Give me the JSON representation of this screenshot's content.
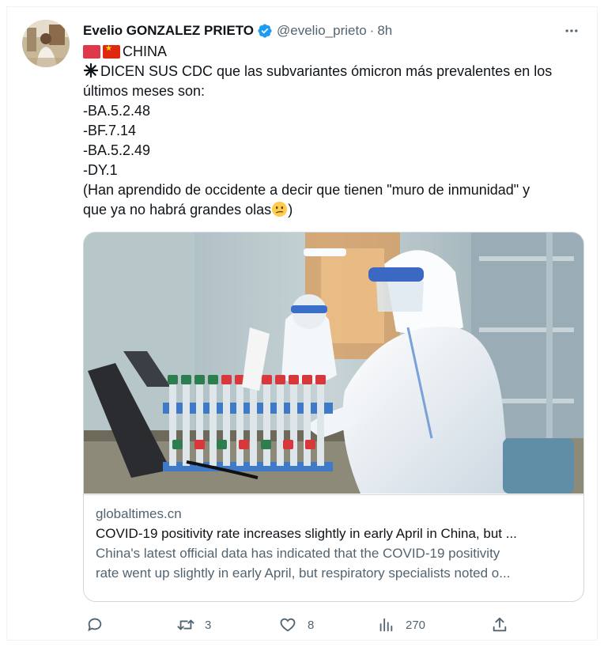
{
  "author": {
    "display_name": "Evelio GONZALEZ PRIETO",
    "verified_icon": "verified-badge-icon",
    "handle": "@evelio_prieto",
    "separator": "·",
    "time": "8h"
  },
  "tweet": {
    "lines": [
      "CHINA",
      "DICEN SUS CDC que las subvariantes ómicron más prevalentes en los",
      "últimos meses son:",
      "-BA.5.2.48",
      "-BF.7.14",
      "-BA.5.2.49",
      "-DY.1",
      "(Han aprendido de occidente a decir que tienen \"muro de inmunidad\" y",
      "que ya no habrá grandes olas",
      ")"
    ]
  },
  "card": {
    "domain": "globaltimes.cn",
    "title": "COVID-19 positivity rate increases slightly in early April in China, but ...",
    "description_lines": [
      "China's latest official data has indicated that the COVID-19 positivity",
      "rate went up slightly in early April, but respiratory specialists noted o..."
    ]
  },
  "actions": {
    "reply": {
      "icon": "reply-icon",
      "count": ""
    },
    "retweet": {
      "icon": "retweet-icon",
      "count": "3"
    },
    "like": {
      "icon": "heart-icon",
      "count": "8"
    },
    "views": {
      "icon": "views-icon",
      "count": "270"
    },
    "share": {
      "icon": "share-icon",
      "count": ""
    }
  },
  "colors": {
    "text_primary": "#0f1419",
    "text_secondary": "#536471",
    "verified": "#1d9bf0",
    "border": "#cfd9de"
  }
}
